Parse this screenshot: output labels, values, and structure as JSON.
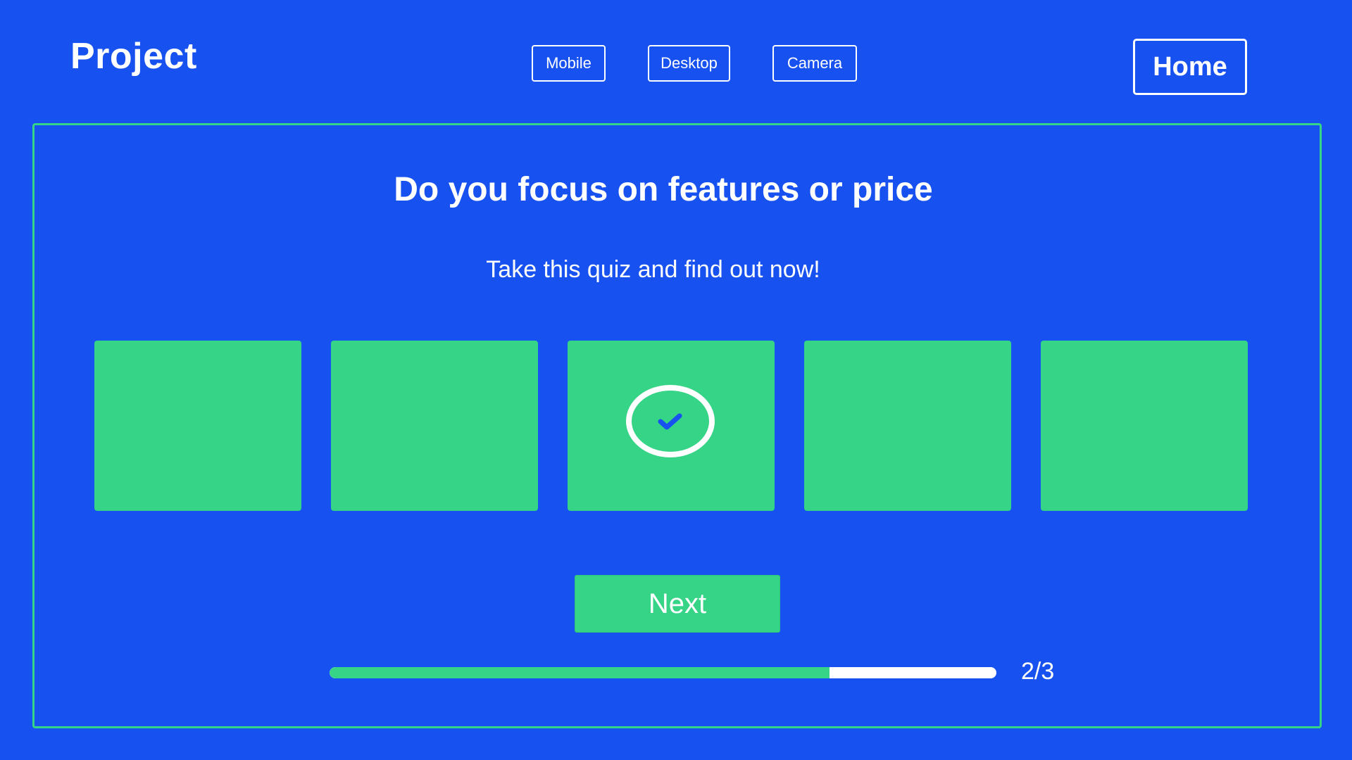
{
  "header": {
    "logo": "Project",
    "nav": [
      {
        "label": "Mobile"
      },
      {
        "label": "Desktop"
      },
      {
        "label": "Camera"
      }
    ],
    "home_label": "Home"
  },
  "quiz": {
    "title": "Do you focus on features or price",
    "subtitle": "Take this quiz and find out now!",
    "options": [
      {
        "selected": false
      },
      {
        "selected": false
      },
      {
        "selected": true
      },
      {
        "selected": false
      },
      {
        "selected": false
      }
    ],
    "next_label": "Next",
    "progress": {
      "fraction": 0.75,
      "label": "2/3"
    }
  },
  "colors": {
    "background": "#1751f0",
    "accent": "#36d486",
    "text": "#ffffff"
  }
}
